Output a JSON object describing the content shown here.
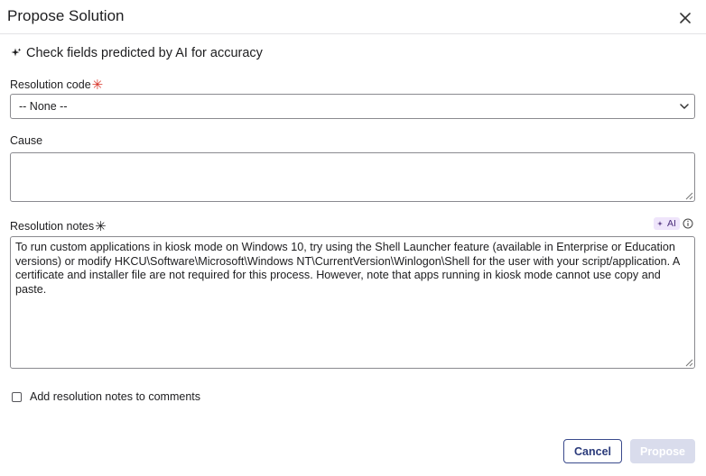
{
  "dialog": {
    "title": "Propose Solution",
    "ai_banner": "Check fields predicted by AI for accuracy"
  },
  "fields": {
    "resolution_code": {
      "label": "Resolution code",
      "required_mark": "✳",
      "value": "-- None --"
    },
    "cause": {
      "label": "Cause",
      "value": ""
    },
    "resolution_notes": {
      "label": "Resolution notes",
      "required_mark": "✳",
      "ai_tag": "AI",
      "value": "To run custom applications in kiosk mode on Windows 10, try using the Shell Launcher feature (available in Enterprise or Education versions) or modify HKCU\\Software\\Microsoft\\Windows NT\\CurrentVersion\\Winlogon\\Shell for the user with your script/application. A certificate and installer file are not required for this process. However, note that apps running in kiosk mode cannot use copy and paste."
    }
  },
  "checkbox": {
    "label": "Add resolution notes to comments",
    "checked": false
  },
  "buttons": {
    "cancel": "Cancel",
    "propose": "Propose"
  },
  "colors": {
    "required": "#d8352a",
    "primary_outline": "#3a4a8c",
    "disabled_primary": "#d9dcec",
    "ai_tag_bg": "#efe5fb"
  },
  "icons": {
    "close": "close-icon",
    "sparkle": "sparkle-icon",
    "chevron": "chevron-down-icon",
    "info": "info-icon"
  }
}
